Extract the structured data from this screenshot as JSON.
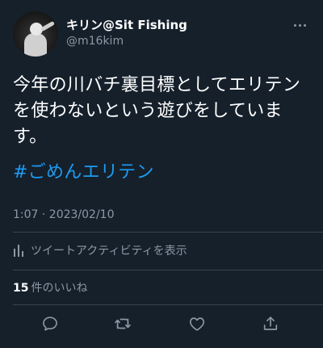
{
  "user": {
    "display_name": "キリン@Sit Fishing",
    "handle": "@m16kim"
  },
  "tweet": {
    "text": "今年の川バチ裏目標としてエリテンを使わないという遊びをしています。",
    "hashtag": "#ごめんエリテン",
    "timestamp": "1:07 · 2023/02/10"
  },
  "analytics": {
    "label": "ツイートアクティビティを表示"
  },
  "likes": {
    "count": "15",
    "label": "件のいいね"
  },
  "icons": {
    "more": "more-icon",
    "analytics": "analytics-bars-icon",
    "reply": "reply-icon",
    "retweet": "retweet-icon",
    "like": "heart-icon",
    "share": "share-icon"
  },
  "colors": {
    "background": "#15202b",
    "text": "#ffffff",
    "secondary": "#8b98a5",
    "accent": "#1d9bf0",
    "divider": "#38444d"
  }
}
